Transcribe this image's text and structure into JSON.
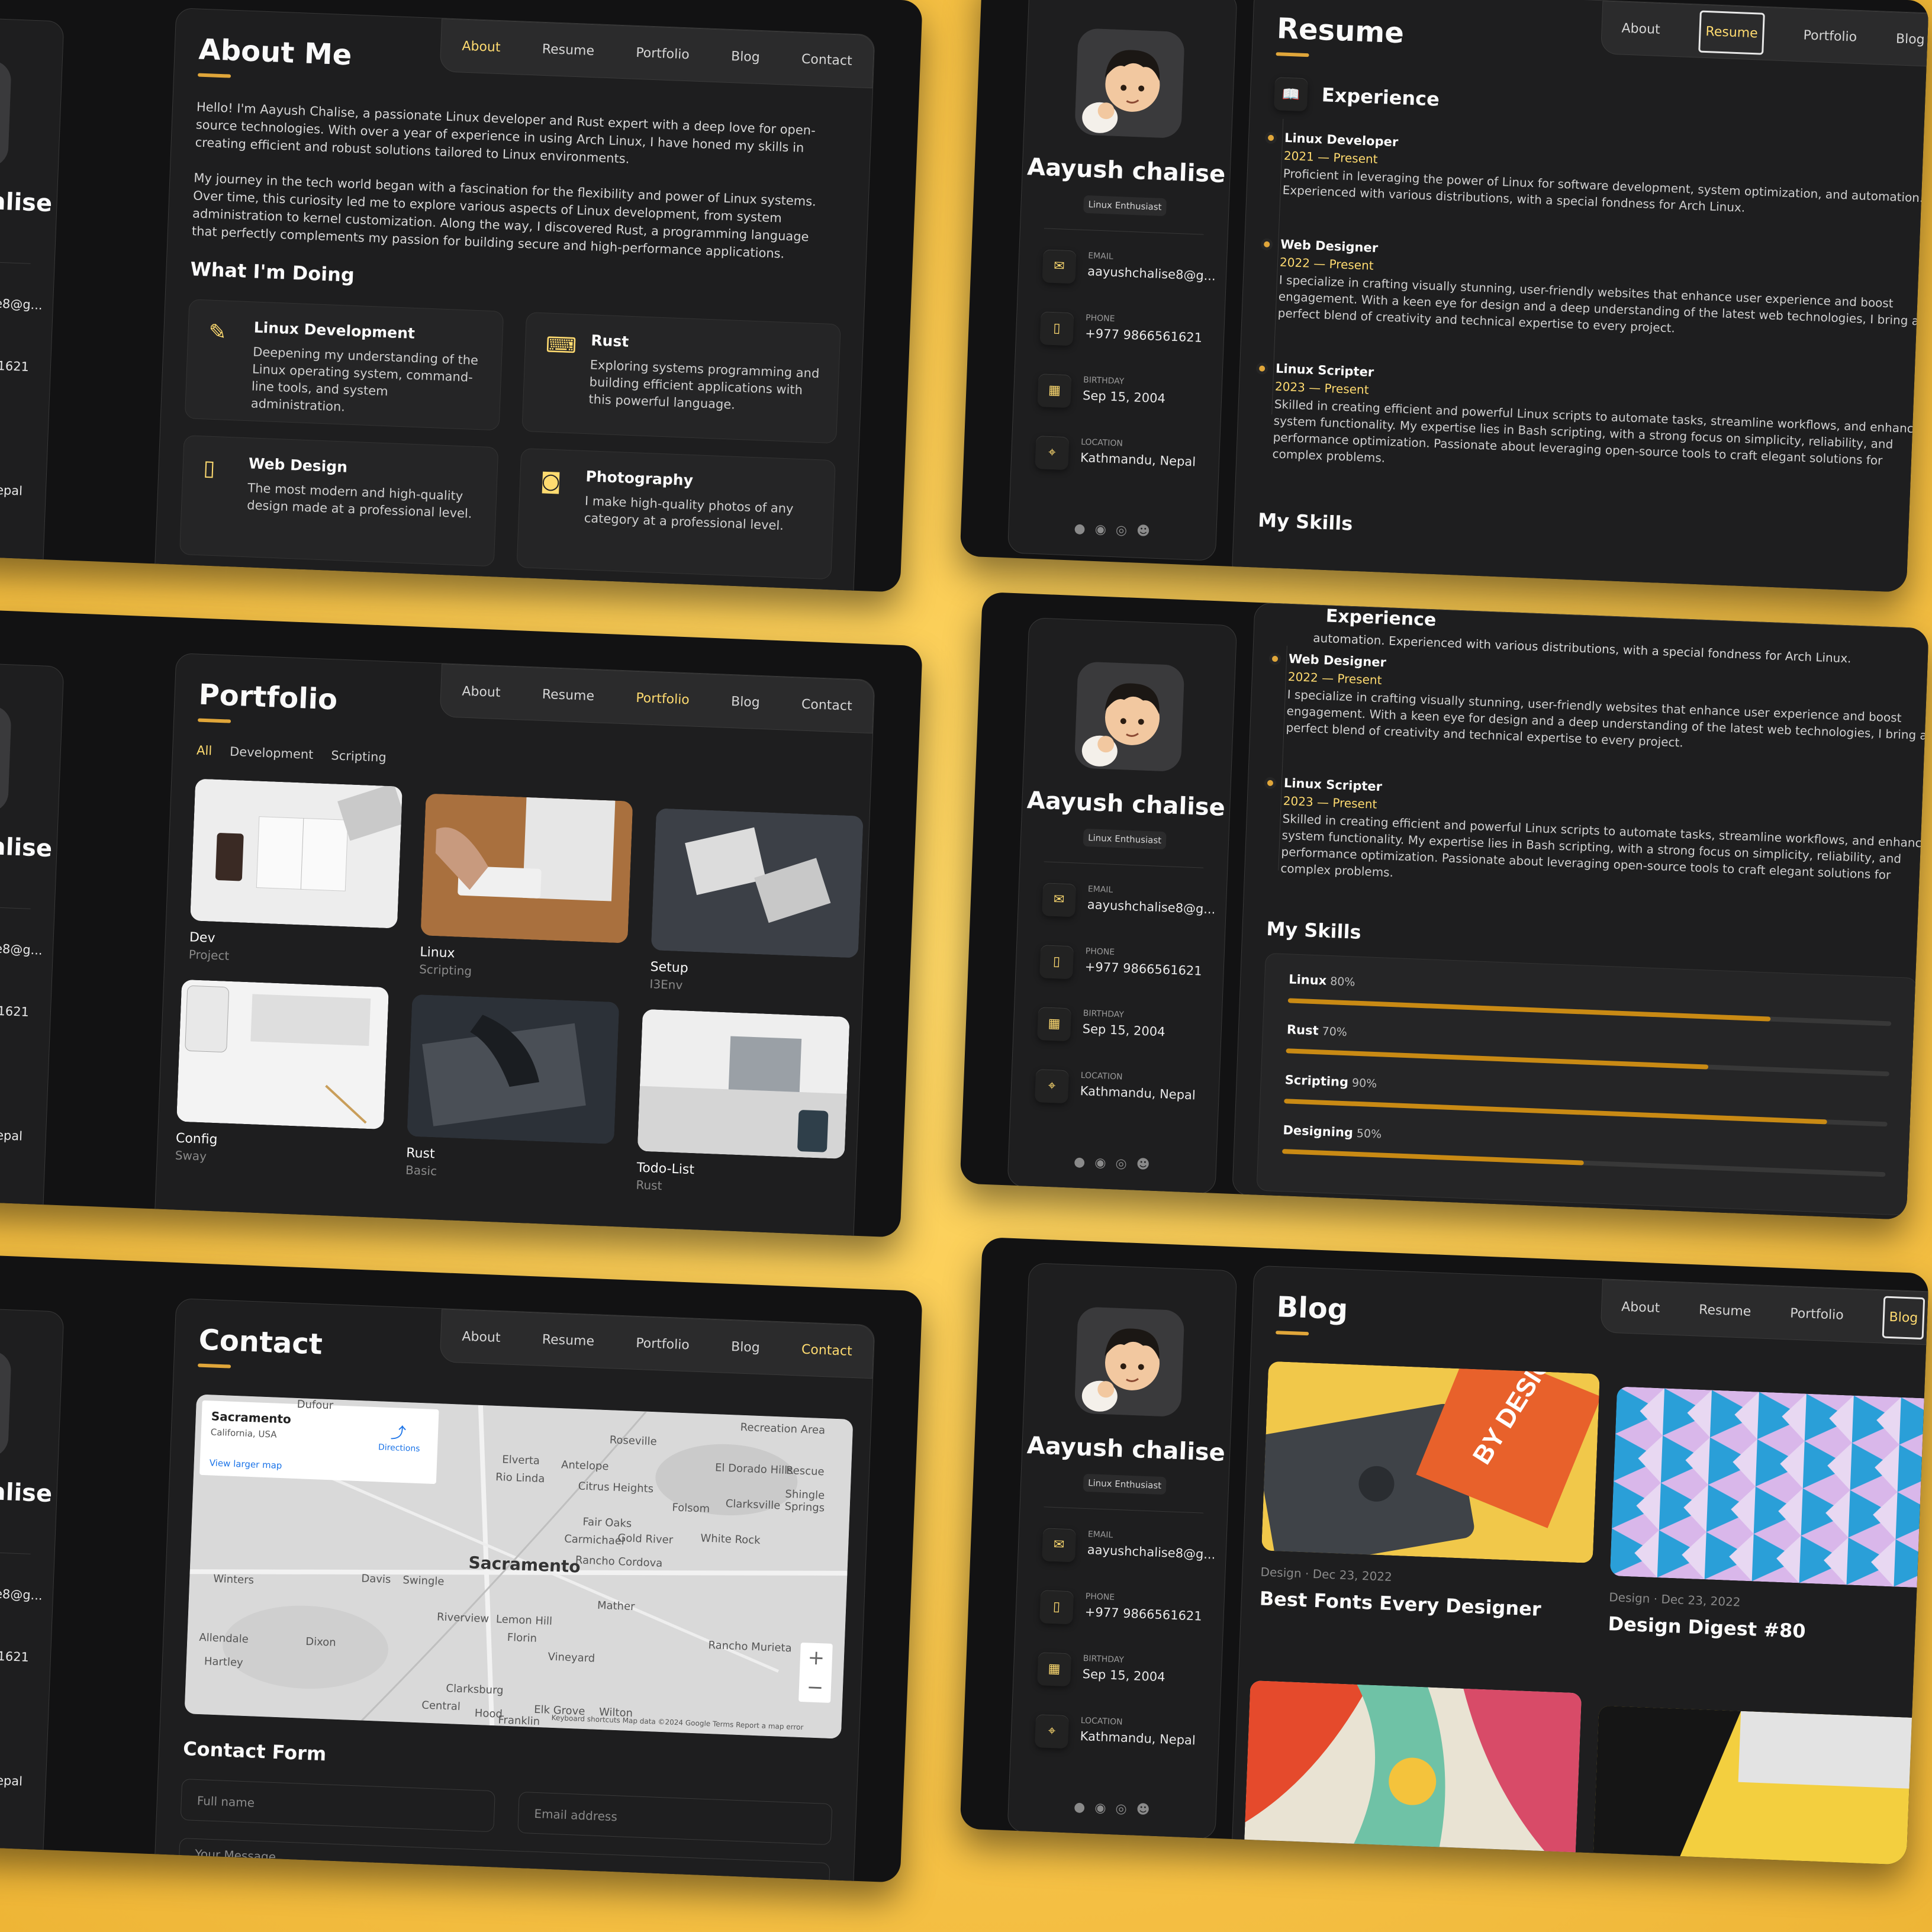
{
  "profile": {
    "name": "Aayush chalise",
    "title": "Linux Enthusiast",
    "contacts": [
      {
        "label": "Email",
        "value": "aayushchalise8@g..."
      },
      {
        "label": "Phone",
        "value": "+977 9866561621"
      },
      {
        "label": "Birthday",
        "value": "Sep 15, 2004"
      },
      {
        "label": "Location",
        "value": "Kathmandu, Nepal"
      }
    ]
  },
  "nav": [
    "About",
    "Resume",
    "Portfolio",
    "Blog",
    "Contact"
  ],
  "about": {
    "title": "About Me",
    "p1": "Hello! I'm Aayush Chalise, a passionate Linux developer and Rust expert with a deep love for open-source technologies. With over a year of experience in using Arch Linux, I have honed my skills in creating efficient and robust solutions tailored to Linux environments.",
    "p2": "My journey in the tech world began with a fascination for the flexibility and power of Linux systems. Over time, this curiosity led me to explore various aspects of Linux development, from system administration to kernel customization. Along the way, I discovered Rust, a programming language that perfectly complements my passion for building secure and high-performance applications.",
    "doing_title": "What I'm Doing",
    "services": [
      {
        "title": "Linux Development",
        "desc": "Deepening my understanding of the Linux operating system, command-line tools, and system administration."
      },
      {
        "title": "Rust",
        "desc": "Exploring systems programming and building efficient applications with this powerful language."
      },
      {
        "title": "Web Design",
        "desc": "The most modern and high-quality design made at a professional level."
      },
      {
        "title": "Photography",
        "desc": "I make high-quality photos of any category at a professional level."
      }
    ]
  },
  "resume": {
    "title": "Resume",
    "experience_title": "Experience",
    "items": [
      {
        "role": "Linux Developer",
        "dates": "2021 — Present",
        "desc": "Proficient in leveraging the power of Linux for software development, system optimization, and automation. Experienced with various distributions, with a special fondness for Arch Linux."
      },
      {
        "role": "Web Designer",
        "dates": "2022 — Present",
        "desc": "I specialize in crafting visually stunning, user-friendly websites that enhance user experience and boost engagement. With a keen eye for design and a deep understanding of the latest web technologies, I bring a perfect blend of creativity and technical expertise to every project."
      },
      {
        "role": "Linux Scripter",
        "dates": "2023 — Present",
        "desc": "Skilled in creating efficient and powerful Linux scripts to automate tasks, streamline workflows, and enhance system functionality. My expertise lies in Bash scripting, with a strong focus on simplicity, reliability, and performance optimization. Passionate about leveraging open-source tools to craft elegant solutions for complex problems."
      }
    ],
    "scrolled_top_line": "automation. Experienced with various distributions, with a special fondness for Arch Linux.",
    "skills_title": "My Skills",
    "skills": [
      {
        "name": "Linux",
        "value": "80%",
        "level": 0.8
      },
      {
        "name": "Rust",
        "value": "70%",
        "level": 0.7
      },
      {
        "name": "Scripting",
        "value": "90%",
        "level": 0.9
      },
      {
        "name": "Designing",
        "value": "50%",
        "level": 0.5
      }
    ]
  },
  "portfolio": {
    "title": "Portfolio",
    "filters": [
      "All",
      "Development",
      "Scripting"
    ],
    "projects": [
      {
        "title": "Dev",
        "category": "Project"
      },
      {
        "title": "Linux",
        "category": "Scripting"
      },
      {
        "title": "Setup",
        "category": "I3Env"
      },
      {
        "title": "Config",
        "category": "Sway"
      },
      {
        "title": "Rust",
        "category": "Basic"
      },
      {
        "title": "Todo-List",
        "category": "Rust"
      }
    ]
  },
  "contact": {
    "title": "Contact",
    "map": {
      "place": "Sacramento",
      "region": "California, USA",
      "larger": "View larger map",
      "directions": "Directions",
      "footer": "Keyboard shortcuts   Map data ©2024 Google   Terms   Report a map error",
      "labels": [
        "Sacramento",
        "Roseville",
        "Citrus Heights",
        "Folsom",
        "Elverta",
        "Antelope",
        "Rio Linda",
        "Fair Oaks",
        "Carmichael",
        "Gold River",
        "Rancho Cordova",
        "Davis",
        "Winters",
        "Dixon",
        "Mather",
        "Elk Grove",
        "Wilton",
        "Clarksburg",
        "Rancho Murieta",
        "Vineyard",
        "Florin",
        "Lemon Hill",
        "Riverview",
        "Allendale",
        "Hartley",
        "Swingle",
        "El Dorado Hills",
        "Rescue",
        "Shingle Springs",
        "Clarksville",
        "White Rock",
        "Dufour",
        "Recreation Area",
        "Hood",
        "Franklin",
        "Central"
      ]
    },
    "form_title": "Contact Form",
    "fullname_ph": "Full name",
    "email_ph": "Email address",
    "message_ph": "Your Message"
  },
  "blog": {
    "title": "Blog",
    "posts": [
      {
        "category": "Design",
        "date": "Dec 23, 2022",
        "title": "Best Fonts Every Designer"
      },
      {
        "category": "Design",
        "date": "Dec 23, 2022",
        "title": "Design Digest #80"
      }
    ],
    "cover_text": "BY DESIGN"
  },
  "colors": {
    "accent": "#ffdb70",
    "panel": "#1e1e1f",
    "bg": "#121213",
    "bar": "#c98a14",
    "backdrop": "#f7c54a"
  }
}
